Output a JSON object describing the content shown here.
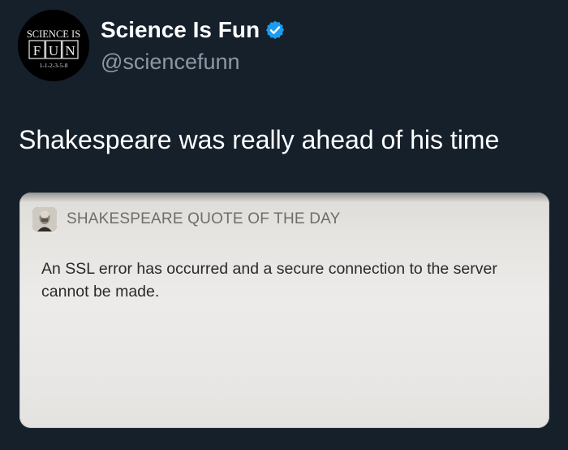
{
  "account": {
    "avatar_lines": [
      "SCIENCE IS",
      "F",
      "U",
      "N",
      "1-1-2-3-5-8"
    ],
    "avatar_icon": "science-is-fun-logo",
    "display_name": "Science Is Fun",
    "verified_icon": "verified-badge-icon",
    "handle": "@sciencefunn"
  },
  "tweet": {
    "text": "Shakespeare was really ahead of his time"
  },
  "notification": {
    "app_icon": "shakespeare-portrait-icon",
    "app_name": "SHAKESPEARE QUOTE OF THE DAY",
    "message": "An SSL error has occurred and a secure connection to the server cannot be made."
  },
  "colors": {
    "background": "#15202b",
    "display_name": "#ffffff",
    "handle": "#8b98a5",
    "verified": "#1d9bf0",
    "card_background": "#ebeae8",
    "card_title": "#6e6d6b",
    "card_text": "#2a2a2a"
  }
}
